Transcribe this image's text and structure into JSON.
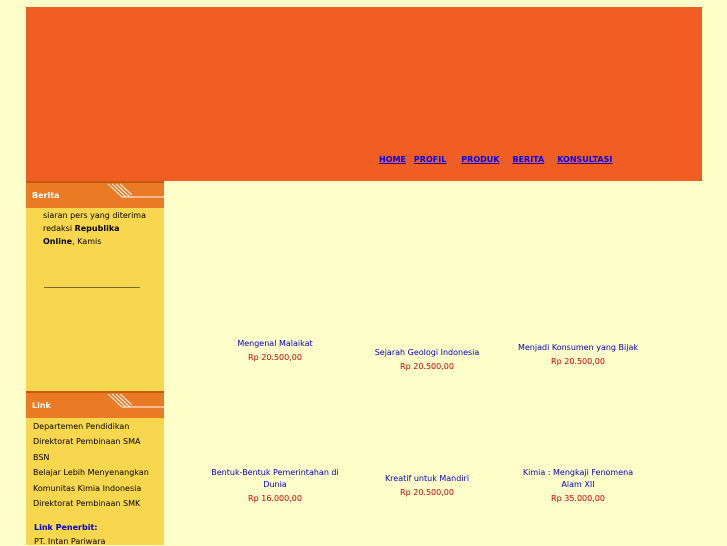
{
  "nav": {
    "items": [
      "HOME",
      "PROFIL",
      "PRODUK",
      "BERITA",
      "KONSULTASI"
    ]
  },
  "sidebar": {
    "berita": {
      "title": "Berita",
      "text_line1": "siaran pers yang diterima",
      "text_line2_prefix": "redaksi ",
      "text_line2_bold": "Republika",
      "text_line3_bold": "Online",
      "text_line3_rest": ", Kamis"
    },
    "link": {
      "title": "Link",
      "items": [
        "Departemen Pendidikan",
        "Direktorat Pembinaan SMA",
        "BSN",
        "Belajar Lebih Menyenangkan",
        "Komunitas Kimia Indonesia",
        "Direktorat Pembinaan SMK"
      ]
    },
    "penerbit": {
      "label": "Link Penerbit:",
      "name": "PT. Intan Pariwara"
    }
  },
  "products": [
    {
      "name": "Mengenal Malaikat",
      "price": "Rp 20.500,00"
    },
    {
      "name": "Sejarah Geologi Indonesia",
      "price": "Rp 20.500,00"
    },
    {
      "name": "Menjadi Konsumen yang Bijak",
      "price": "Rp 20.500,00"
    },
    {
      "name": "Bentuk-Bentuk Pemerintahan di Dunia",
      "price": "Rp 16.000,00"
    },
    {
      "name": "Kreatif untuk Mandiri",
      "price": "Rp 20.500,00"
    },
    {
      "name": "Kimia : Mengkaji Fenomena Alam XII",
      "price": "Rp 35.000,00"
    }
  ],
  "colors": {
    "header": "#f05e23",
    "sidebar": "#f8d64d",
    "sidebar_header": "#eb7a24",
    "page_bg": "#ffffc9",
    "price": "#cc0000",
    "link": "#0000cc"
  }
}
